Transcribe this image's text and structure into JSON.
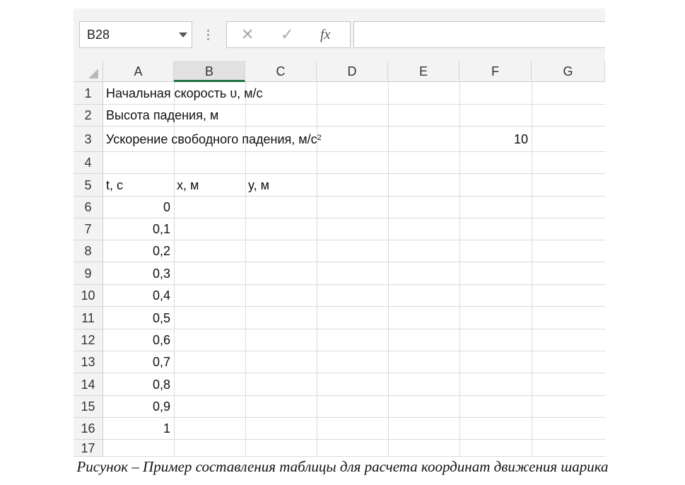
{
  "formula_bar": {
    "name_box": "B28",
    "cancel_glyph": "✕",
    "enter_glyph": "✓",
    "fx_label": "fx",
    "formula": ""
  },
  "columns": [
    "A",
    "B",
    "C",
    "D",
    "E",
    "F",
    "G"
  ],
  "selected_column": "B",
  "rows": [
    "1",
    "2",
    "3",
    "4",
    "5",
    "6",
    "7",
    "8",
    "9",
    "10",
    "11",
    "12",
    "13",
    "14",
    "15",
    "16",
    "17"
  ],
  "cells": {
    "A1": "Начальная скорость υ, м/с",
    "A2": "Высота падения, м",
    "A3": "Ускорение свободного падения, м/с",
    "A3_sup": "2",
    "F3": "10",
    "A5": "t, c",
    "B5": "x, м",
    "C5": "y, м",
    "A6": "0",
    "A7": "0,1",
    "A8": "0,2",
    "A9": "0,3",
    "A10": "0,4",
    "A11": "0,5",
    "A12": "0,6",
    "A13": "0,7",
    "A14": "0,8",
    "A15": "0,9",
    "A16": "1"
  },
  "caption": "Рисунок – Пример составления таблицы для расчета координат движения шарика",
  "colors": {
    "accent": "#217346",
    "header_bg": "#f3f3f3",
    "grid_line": "#dadada"
  }
}
